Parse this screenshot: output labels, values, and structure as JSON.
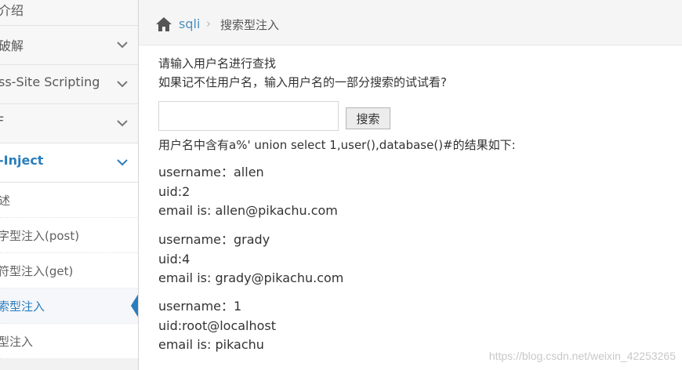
{
  "sidebar": {
    "items": [
      {
        "label": "介绍",
        "expandable": false
      },
      {
        "label": "破解",
        "expandable": true
      },
      {
        "label": "ss-Site Scripting",
        "expandable": true
      },
      {
        "label": "F",
        "expandable": true
      },
      {
        "label": "-Inject",
        "expandable": true,
        "active": true
      }
    ],
    "subitems": [
      {
        "label": "述"
      },
      {
        "label": "字型注入(post)"
      },
      {
        "label": "符型注入(get)"
      },
      {
        "label": "索型注入",
        "selected": true
      },
      {
        "label": "型注入"
      }
    ]
  },
  "breadcrumb": {
    "home_icon": "home-icon",
    "link": "sqli",
    "separator": "›",
    "current": "搜索型注入"
  },
  "main": {
    "intro_line1": "请输入用户名进行查找",
    "intro_line2": "如果记不住用户名，输入用户名的一部分搜索的试试看?",
    "search_input_value": "",
    "search_button": "搜索",
    "result_header": "用户名中含有a%' union select 1,user(),database()#的结果如下:",
    "records": [
      {
        "username": "username：allen",
        "uid": "uid:2",
        "email": "email is: allen@pikachu.com"
      },
      {
        "username": "username：grady",
        "uid": "uid:4",
        "email": "email is: grady@pikachu.com"
      },
      {
        "username": "username：1",
        "uid": "uid:root@localhost",
        "email": "email is: pikachu"
      }
    ]
  },
  "watermark": "https://blog.csdn.net/weixin_42253265",
  "colors": {
    "accent": "#2b7dbc",
    "link": "#4c8fbd"
  }
}
